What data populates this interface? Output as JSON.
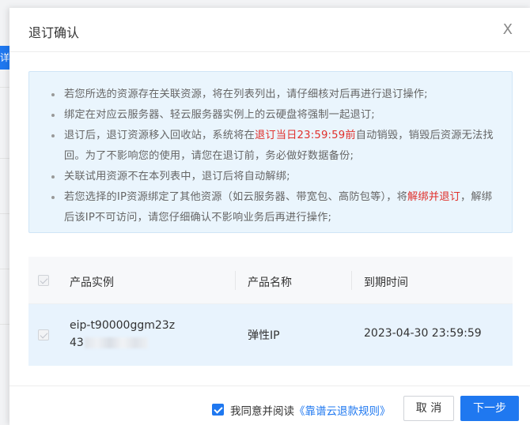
{
  "dialog": {
    "title": "退订确认",
    "close_glyph": "X"
  },
  "background": {
    "button_label": "详"
  },
  "notice": {
    "items": [
      {
        "parts": [
          {
            "text": "若您所选的资源存在关联资源，将在列表列出，请仔细核对后再进行退订操作;",
            "color": "normal"
          }
        ]
      },
      {
        "parts": [
          {
            "text": "绑定在对应云服务器、轻云服务器实例上的云硬盘将强制一起退订;",
            "color": "normal"
          }
        ]
      },
      {
        "parts": [
          {
            "text": "退订后，退订资源移入回收站，系统将在",
            "color": "normal"
          },
          {
            "text": "退订当日23:59:59前",
            "color": "red"
          },
          {
            "text": "自动销毁，销毁后资源无法找回。为了不影响您的使用，请您在退订前，务必做好数据备份;",
            "color": "normal"
          }
        ]
      },
      {
        "parts": [
          {
            "text": "关联试用资源不在本列表中，退订后将自动解绑;",
            "color": "normal"
          }
        ]
      },
      {
        "parts": [
          {
            "text": "若您选择的IP资源绑定了其他资源（如云服务器、带宽包、高防包等），将",
            "color": "normal"
          },
          {
            "text": "解绑并退订",
            "color": "red"
          },
          {
            "text": "，解绑后该IP不可访问，请您仔细确认不影响业务后再进行操作;",
            "color": "normal"
          }
        ]
      }
    ],
    "red_color": "#e0302b"
  },
  "table": {
    "headers": {
      "instance": "产品实例",
      "product": "产品名称",
      "expire": "到期时间"
    },
    "rows": [
      {
        "instance_line1": "eip-t90000ggm23z",
        "instance_line2": "43",
        "product": "弹性IP",
        "expire": "2023-04-30 23:59:59"
      }
    ]
  },
  "footer": {
    "agree_prefix": "我同意并阅读",
    "agree_link": "《靠谱云退款规则》",
    "cancel_label": "取 消",
    "next_label": "下一步"
  },
  "colors": {
    "accent": "#1f78f0",
    "notice_bg": "#eaf5fd",
    "row_selected_bg": "#e8f3fd"
  }
}
